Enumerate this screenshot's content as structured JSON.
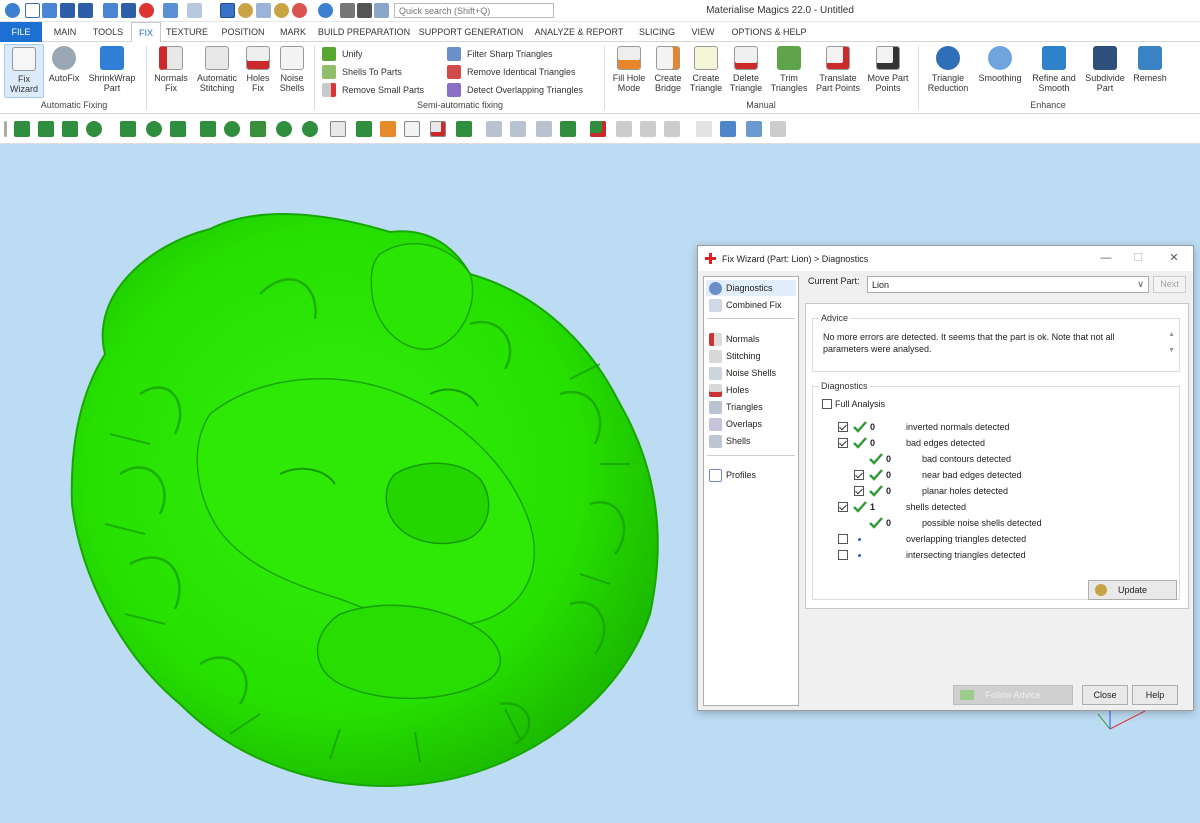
{
  "window": {
    "title": "Materialise Magics 22.0 - Untitled",
    "search_placeholder": "Quick search (Shift+Q)"
  },
  "menu": [
    "FILE",
    "MAIN",
    "TOOLS",
    "FIX",
    "TEXTURE",
    "POSITION",
    "MARK",
    "BUILD PREPARATION",
    "SUPPORT GENERATION",
    "ANALYZE & REPORT",
    "SLICING",
    "VIEW",
    "OPTIONS & HELP"
  ],
  "active_menu": "FIX",
  "ribbon": {
    "automatic_fixing": {
      "label": "Automatic Fixing",
      "buttons": [
        [
          "Fix",
          "Wizard"
        ],
        [
          "AutoFix",
          ""
        ],
        [
          "ShrinkWrap",
          "Part"
        ]
      ]
    },
    "fix_buttons": [
      [
        "Normals",
        "Fix"
      ],
      [
        "Automatic",
        "Stitching"
      ],
      [
        "Holes",
        "Fix"
      ],
      [
        "Noise",
        "Shells"
      ]
    ],
    "semi_automatic": {
      "label": "Semi-automatic fixing",
      "items": [
        "Unify",
        "Shells To Parts",
        "Remove Small Parts",
        "Filter Sharp Triangles",
        "Remove Identical Triangles",
        "Detect Overlapping Triangles"
      ]
    },
    "manual": {
      "label": "Manual",
      "buttons": [
        [
          "Fill Hole",
          "Mode"
        ],
        [
          "Create",
          "Bridge"
        ],
        [
          "Create",
          "Triangle"
        ],
        [
          "Delete",
          "Triangle"
        ],
        [
          "Trim",
          "Triangles"
        ],
        [
          "Translate",
          "Part Points"
        ],
        [
          "Move Part",
          "Points"
        ]
      ]
    },
    "enhance": {
      "label": "Enhance",
      "buttons": [
        [
          "Triangle",
          "Reduction"
        ],
        [
          "Smoothing",
          ""
        ],
        [
          "Refine and",
          "Smooth"
        ],
        [
          "Subdivide",
          "Part"
        ],
        [
          "Remesh",
          ""
        ]
      ]
    }
  },
  "colors": {
    "viewport_bg": "#bcdcf4",
    "model_green": "#26e000",
    "accent_blue": "#1d6fd1",
    "check_green": "#2f9a2f"
  },
  "dialog": {
    "title": "Fix Wizard (Part: Lion) > Diagnostics",
    "nav": {
      "diagnostics": "Diagnostics",
      "combined_fix": "Combined Fix",
      "normals": "Normals",
      "stitching": "Stitching",
      "noise_shells": "Noise Shells",
      "holes": "Holes",
      "triangles": "Triangles",
      "overlaps": "Overlaps",
      "shells": "Shells",
      "profiles": "Profiles"
    },
    "current_part_label": "Current Part:",
    "current_part_value": "Lion",
    "next_button": "Next",
    "advice_label": "Advice",
    "advice_text": "No more errors are detected. It seems that the part is ok. Note that not all parameters were analysed.",
    "diagnostics_label": "Diagnostics",
    "full_analysis": "Full Analysis",
    "rows": {
      "inverted_normals": {
        "count": "0",
        "label": "inverted normals detected"
      },
      "bad_edges": {
        "count": "0",
        "label": "bad edges detected"
      },
      "bad_contours": {
        "count": "0",
        "label": "bad contours detected"
      },
      "near_bad_edges": {
        "count": "0",
        "label": "near bad edges detected"
      },
      "planar_holes": {
        "count": "0",
        "label": "planar holes detected"
      },
      "shells": {
        "count": "1",
        "label": "shells detected"
      },
      "noise_shells": {
        "count": "0",
        "label": "possible noise shells detected"
      },
      "overlapping": {
        "label": "overlapping triangles detected"
      },
      "intersecting": {
        "label": "intersecting triangles detected"
      }
    },
    "update_button": "Update",
    "follow_advice_button": "Follow Advice",
    "close_button": "Close",
    "help_button": "Help"
  }
}
